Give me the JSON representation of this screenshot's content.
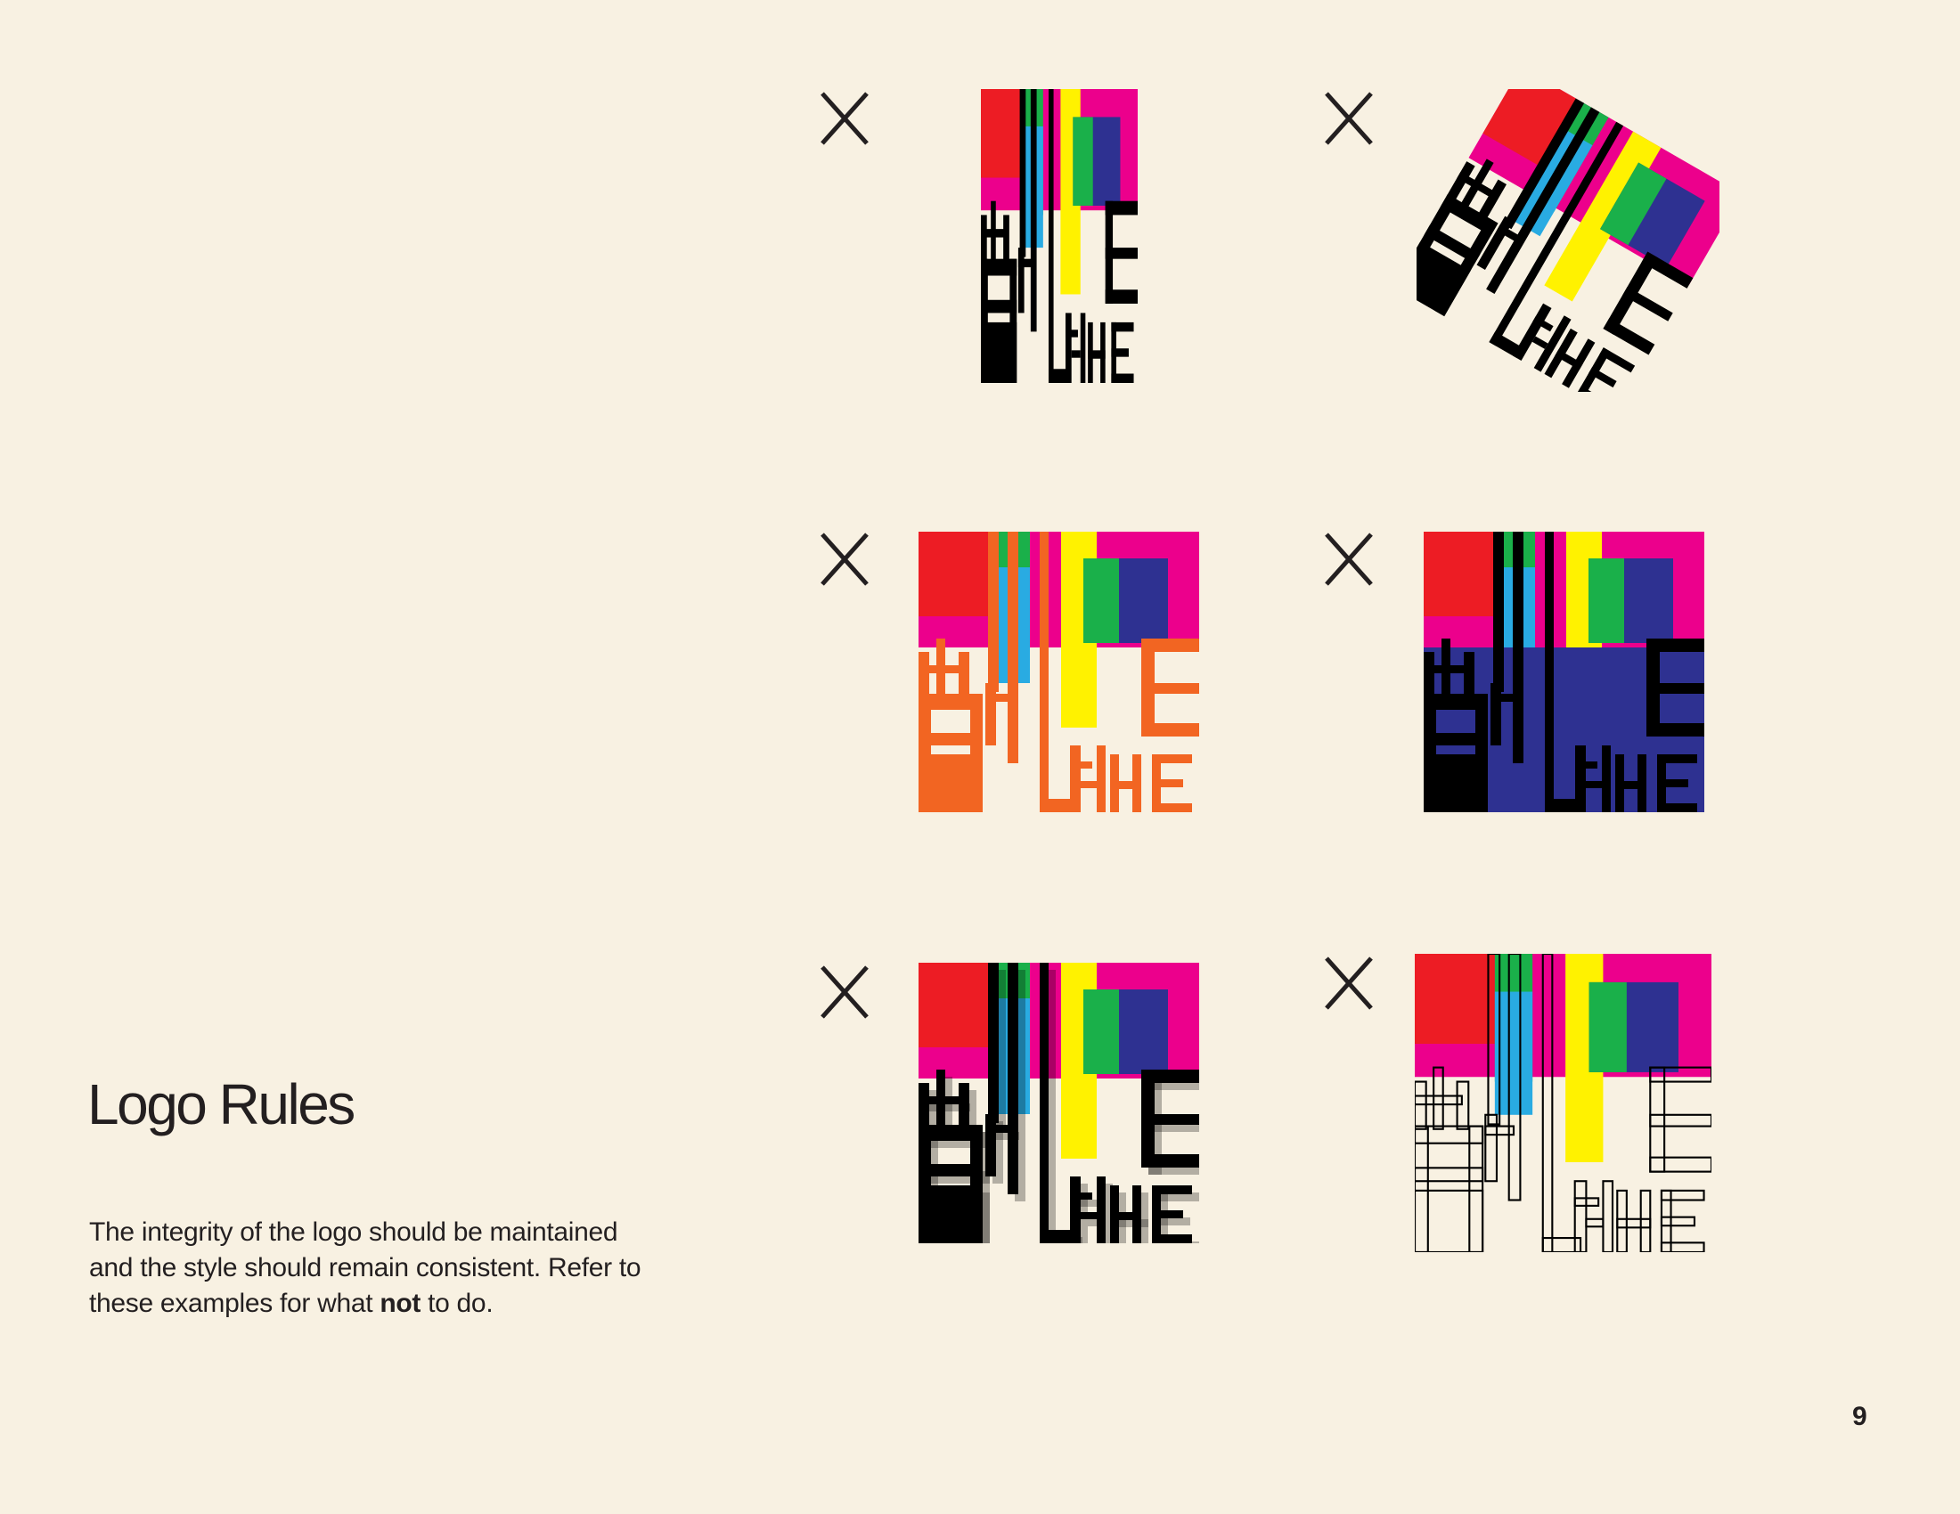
{
  "page": {
    "title": "Logo Rules",
    "description": {
      "before": "The integrity of the logo should be maintained and the style should remain consistent. Refer to these examples for what ",
      "emphasis": "not",
      "after": " to do."
    },
    "page_number": "9"
  },
  "colors": {
    "background": "#F8F1E2",
    "panel": "#EC008C",
    "magenta": "#EC008C",
    "red": "#ED1C24",
    "green": "#1AB04A",
    "blue": "#29ABE2",
    "yellow": "#FFF200",
    "navy": "#2E3191",
    "orange": "#F26522",
    "black": "#000000",
    "text": "#231F20"
  },
  "examples": [
    {
      "id": "stretched",
      "logo_text": "BETHLEHEM",
      "mark": "x-icon"
    },
    {
      "id": "rotated",
      "logo_text": "BETHLEHEM",
      "mark": "x-icon"
    },
    {
      "id": "recolored-letters",
      "logo_text": "BETHLEHEM",
      "mark": "x-icon"
    },
    {
      "id": "dark-background",
      "logo_text": "BETHLEHEM",
      "mark": "x-icon"
    },
    {
      "id": "drop-shadow",
      "logo_text": "BETHLEHEM",
      "mark": "x-icon"
    },
    {
      "id": "outlined-letters",
      "logo_text": "BETHLEHEM",
      "mark": "x-icon"
    }
  ]
}
